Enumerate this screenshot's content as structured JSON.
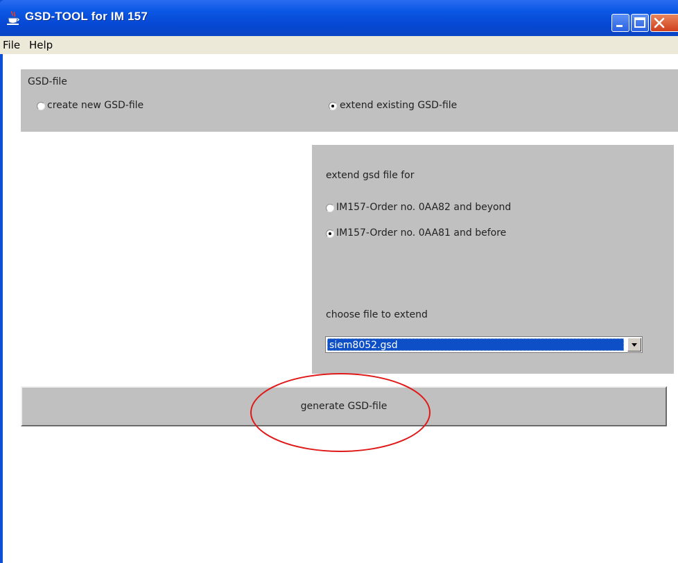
{
  "window": {
    "title": "GSD-TOOL for IM 157"
  },
  "menu": {
    "items": [
      "File",
      "Help"
    ]
  },
  "gsd_file_panel": {
    "heading": "GSD-file",
    "options": [
      {
        "label": "create new GSD-file",
        "checked": false
      },
      {
        "label": "extend existing GSD-file",
        "checked": true
      }
    ]
  },
  "extend_panel": {
    "heading": "extend gsd file for",
    "options": [
      {
        "label": "IM157-Order no. 0AA82 and beyond",
        "checked": false
      },
      {
        "label": "IM157-Order no. 0AA81 and before",
        "checked": true
      }
    ],
    "choose_label": "choose file to extend",
    "selected_file": "siem8052.gsd"
  },
  "actions": {
    "generate_label": "generate GSD-file"
  },
  "colors": {
    "titlebar": "#0b58e4",
    "panel": "#c0c0c0",
    "selection": "#0d4fc6",
    "annotation": "#e01818"
  },
  "icons": [
    "java-cup-icon",
    "minimize-icon",
    "maximize-icon",
    "close-icon",
    "chevron-down-icon"
  ]
}
